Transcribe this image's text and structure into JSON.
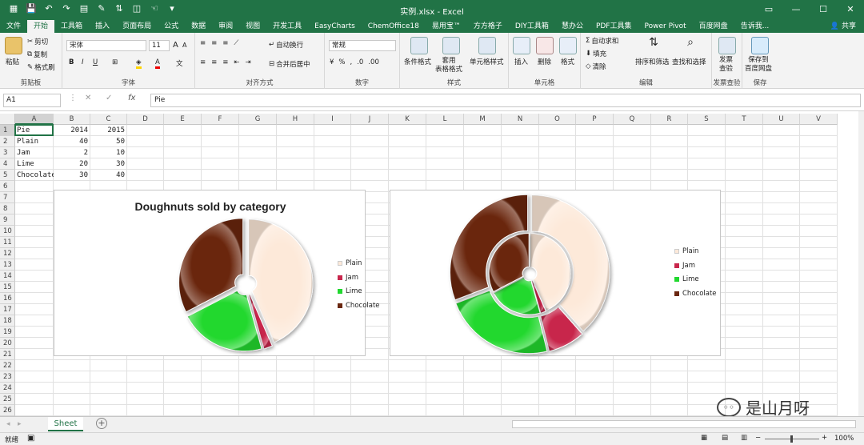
{
  "window": {
    "title": "实例.xlsx - Excel"
  },
  "menu": {
    "tabs": [
      "文件",
      "开始",
      "工具箱",
      "插入",
      "页面布局",
      "公式",
      "数据",
      "审阅",
      "视图",
      "开发工具",
      "EasyCharts",
      "ChemOffice18",
      "易用宝™",
      "方方格子",
      "DIY工具箱",
      "慧办公",
      "PDF工具集",
      "Power Pivot",
      "百度网盘",
      "告诉我..."
    ],
    "active": 1,
    "share": "共享"
  },
  "ribbon": {
    "clipboard": {
      "paste": "粘贴",
      "cut": "剪切",
      "copy": "复制",
      "format_painter": "格式刷",
      "label": "剪贴板"
    },
    "font": {
      "name": "宋体",
      "size": "11",
      "label": "字体",
      "bold": "B",
      "italic": "I",
      "underline": "U",
      "grow": "A",
      "shrink": "A",
      "color": "A"
    },
    "alignment": {
      "wrap": "自动换行",
      "merge": "合并后居中",
      "label": "对齐方式"
    },
    "number": {
      "format": "常规",
      "label": "数字"
    },
    "styles": {
      "conditional": "条件格式",
      "table": "套用\n表格格式",
      "cell_styles": "单元格样式",
      "label": "样式"
    },
    "cells": {
      "insert": "插入",
      "delete": "删除",
      "format": "格式",
      "label": "单元格"
    },
    "editing": {
      "autosum": "自动求和",
      "fill": "填充",
      "clear": "清除",
      "sort": "排序和筛选",
      "find": "查找和选择",
      "label": "编辑"
    },
    "invoice": {
      "check": "发票\n查验",
      "label": "发票查验"
    },
    "save": {
      "baidu": "保存到\n百度网盘",
      "label": "保存"
    }
  },
  "formula": {
    "namebox": "A1",
    "fx": "fx",
    "content": "Pie"
  },
  "columns": [
    "A",
    "B",
    "C",
    "D",
    "E",
    "F",
    "G",
    "H",
    "I",
    "J",
    "K",
    "L",
    "M",
    "N",
    "O",
    "P",
    "Q",
    "R",
    "S",
    "T",
    "U",
    "V"
  ],
  "rows": [
    "1",
    "2",
    "3",
    "4",
    "5",
    "6",
    "7",
    "8",
    "9",
    "10",
    "11",
    "12",
    "13",
    "14",
    "15",
    "16",
    "17",
    "18",
    "19",
    "20",
    "21",
    "22",
    "23",
    "24",
    "25",
    "26"
  ],
  "cells": [
    [
      "Pie",
      "2014",
      "2015"
    ],
    [
      "Plain",
      "40",
      "50"
    ],
    [
      "Jam",
      "2",
      "10"
    ],
    [
      "Lime",
      "20",
      "30"
    ],
    [
      "Chocolate",
      "30",
      "40"
    ]
  ],
  "chart1": {
    "title": "Doughnuts sold by category",
    "type": "doughnut-exploded",
    "series": "2014"
  },
  "chart2": {
    "title": "",
    "type": "doughnut",
    "series": [
      "2014",
      "2015"
    ]
  },
  "chart_data": [
    {
      "type": "pie",
      "title": "Doughnuts sold by category",
      "categories": [
        "Plain",
        "Jam",
        "Lime",
        "Chocolate"
      ],
      "values": [
        40,
        2,
        20,
        30
      ],
      "colors": [
        "#fde9d9",
        "#c8264c",
        "#21d82f",
        "#6a2710"
      ],
      "legend": "right"
    },
    {
      "type": "pie",
      "title": "",
      "categories": [
        "Plain",
        "Jam",
        "Lime",
        "Chocolate"
      ],
      "series": [
        {
          "name": "2014",
          "values": [
            40,
            2,
            20,
            30
          ]
        },
        {
          "name": "2015",
          "values": [
            50,
            10,
            30,
            40
          ]
        }
      ],
      "colors": [
        "#fde9d9",
        "#c8264c",
        "#21d82f",
        "#6a2710"
      ],
      "legend": "right"
    }
  ],
  "sheet": {
    "tab": "Sheet",
    "add": "+"
  },
  "status": {
    "ready": "就绪",
    "zoom": "100%"
  },
  "watermark": "是山月呀"
}
